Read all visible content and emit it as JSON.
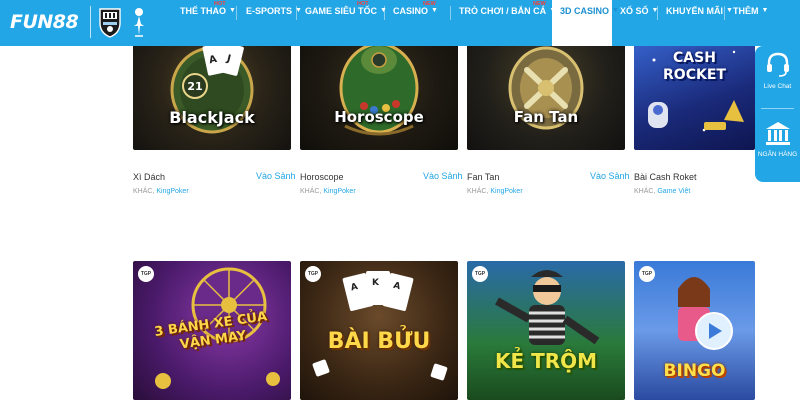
{
  "header": {
    "logo": "FUN88",
    "nav": [
      {
        "label": "THỂ THAO",
        "badge": "HOT",
        "chevron": true,
        "active": false
      },
      {
        "label": "E-SPORTS",
        "badge": "",
        "chevron": true,
        "active": false
      },
      {
        "label": "GAME SIÊU TỐC",
        "badge": "HOT",
        "chevron": true,
        "active": false
      },
      {
        "label": "CASINO",
        "badge": "NEW",
        "chevron": true,
        "active": false
      },
      {
        "label": "TRÒ CHƠI / BẮN CÁ",
        "badge": "NEW",
        "chevron": true,
        "active": false
      },
      {
        "label": "3D CASINO",
        "badge": "",
        "chevron": true,
        "active": true
      },
      {
        "label": "XỔ SỐ",
        "badge": "",
        "chevron": true,
        "active": false
      },
      {
        "label": "KHUYẾN MÃI",
        "badge": "",
        "chevron": true,
        "active": false
      },
      {
        "label": "THÊM",
        "badge": "",
        "chevron": true,
        "active": false
      }
    ]
  },
  "games_row1": [
    {
      "art_title": "BlackJack",
      "name": "Xì Dách",
      "category": "KHÁC,",
      "provider": "KingPoker",
      "action": "Vào Sảnh"
    },
    {
      "art_title": "Horoscope",
      "name": "Horoscope",
      "category": "KHÁC,",
      "provider": "KingPoker",
      "action": "Vào Sảnh"
    },
    {
      "art_title": "Fan Tan",
      "name": "Fan Tan",
      "category": "KHÁC,",
      "provider": "KingPoker",
      "action": "Vào Sảnh"
    },
    {
      "art_title": "CASH ROCKET",
      "name": "Bài Cash Roket",
      "category": "KHÁC,",
      "provider": "Game Việt",
      "action": ""
    }
  ],
  "games_row2": [
    {
      "art_title": "3 BÁNH XE CỦA VẬN MAY",
      "badge": "TGP"
    },
    {
      "art_title": "BÀI BỬU",
      "badge": "TGP"
    },
    {
      "art_title": "KẺ TRỘM",
      "badge": "TGP"
    },
    {
      "art_title": "BINGO",
      "badge": "TGP"
    }
  ],
  "side_tools": {
    "live_chat": "Live Chat",
    "bank": "NGÂN HÀNG"
  },
  "colors": {
    "header_bg": "#22a6e6",
    "link": "#22a6e6",
    "badge_hot": "#ff3b30"
  }
}
